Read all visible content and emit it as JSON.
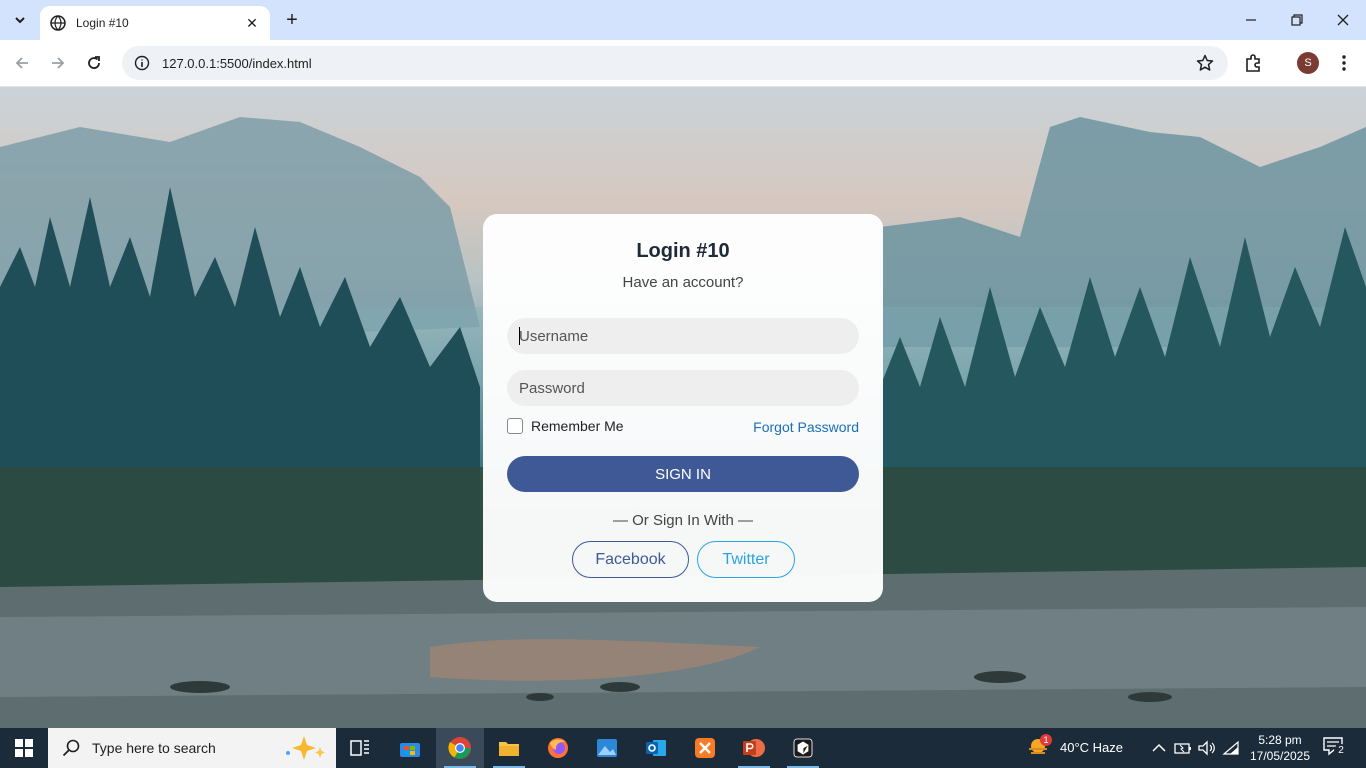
{
  "browser": {
    "tab_title": "Login #10",
    "url": "127.0.0.1:5500/index.html",
    "profile_initial": "S"
  },
  "login": {
    "heading": "Login #10",
    "subheading": "Have an account?",
    "username_placeholder": "Username",
    "password_placeholder": "Password",
    "remember_label": "Remember Me",
    "forgot_label": "Forgot Password",
    "signin_label": "SIGN IN",
    "or_text": "— Or Sign In With —",
    "facebook_label": "Facebook",
    "twitter_label": "Twitter"
  },
  "taskbar": {
    "search_placeholder": "Type here to search",
    "weather": "40°C  Haze",
    "weather_badge": "1",
    "time": "5:28 pm",
    "date": "17/05/2025",
    "notification_count": "2"
  },
  "colors": {
    "primary": "#3f5996",
    "link": "#1c6fb8",
    "twitter": "#2aa4e0"
  }
}
